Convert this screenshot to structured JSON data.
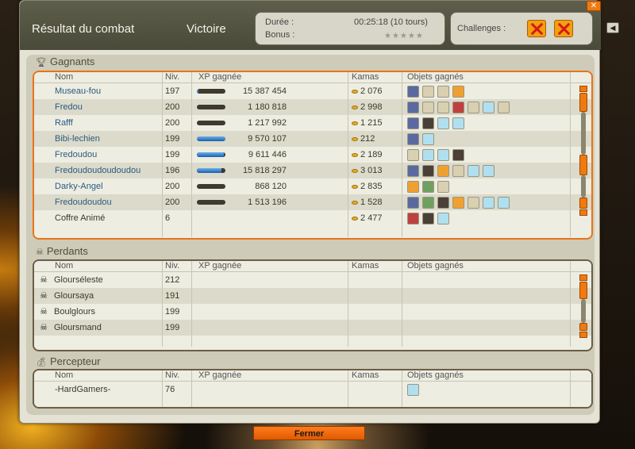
{
  "header": {
    "title": "Résultat du combat",
    "result": "Victoire",
    "duration_label": "Durée :",
    "duration_value": "00:25:18 (10 tours)",
    "bonus_label": "Bonus :",
    "bonus_stars": "★★★★★",
    "challenges_label": "Challenges :"
  },
  "columns": {
    "name": "Nom",
    "level": "Niv.",
    "xp": "XP gagnée",
    "kamas": "Kamas",
    "items": "Objets gagnés"
  },
  "winners": {
    "title": "Gagnants",
    "rows": [
      {
        "name": "Museau-fou",
        "level": "197",
        "xp": "15 387 454",
        "xp_fill": 0.05,
        "kamas": "2 076",
        "items": [
          "t-blue",
          "t-bone",
          "t-bone",
          "t-orange"
        ],
        "link": true
      },
      {
        "name": "Fredou",
        "level": "200",
        "xp": "1 180 818",
        "xp_fill": 0.0,
        "kamas": "2 998",
        "items": [
          "t-blue",
          "t-bone",
          "t-bone",
          "t-red",
          "t-bone",
          "t-cloud",
          "t-bone"
        ],
        "link": true
      },
      {
        "name": "Rafff",
        "level": "200",
        "xp": "1 217 992",
        "xp_fill": 0.0,
        "kamas": "1 215",
        "items": [
          "t-blue",
          "t-dark",
          "t-cloud",
          "t-cloud"
        ],
        "link": true
      },
      {
        "name": "Bibi-lechien",
        "level": "199",
        "xp": "9 570 107",
        "xp_fill": 1.0,
        "kamas": "212",
        "items": [
          "t-blue",
          "t-cloud"
        ],
        "link": true
      },
      {
        "name": "Fredoudou",
        "level": "199",
        "xp": "9 611 446",
        "xp_fill": 0.95,
        "kamas": "2 189",
        "items": [
          "t-bone",
          "t-cloud",
          "t-cloud",
          "t-dark"
        ],
        "link": true
      },
      {
        "name": "Fredoudoudoudoudou",
        "level": "196",
        "xp": "15 818 297",
        "xp_fill": 0.85,
        "kamas": "3 013",
        "items": [
          "t-blue",
          "t-dark",
          "t-orange",
          "t-bone",
          "t-cloud",
          "t-cloud"
        ],
        "link": true
      },
      {
        "name": "Darky-Angel",
        "level": "200",
        "xp": "868 120",
        "xp_fill": 0.0,
        "kamas": "2 835",
        "items": [
          "t-orange",
          "t-green",
          "t-bone"
        ],
        "link": true
      },
      {
        "name": "Fredoudoudou",
        "level": "200",
        "xp": "1 513 196",
        "xp_fill": 0.0,
        "kamas": "1 528",
        "items": [
          "t-blue",
          "t-green",
          "t-dark",
          "t-orange",
          "t-bone",
          "t-cloud",
          "t-cloud"
        ],
        "link": true
      },
      {
        "name": "Coffre Animé",
        "level": "6",
        "xp": "",
        "xp_fill": null,
        "kamas": "2 477",
        "items": [
          "t-red",
          "t-dark",
          "t-cloud"
        ],
        "link": false
      }
    ]
  },
  "losers": {
    "title": "Perdants",
    "rows": [
      {
        "name": "Glourséleste",
        "level": "212"
      },
      {
        "name": "Gloursaya",
        "level": "191"
      },
      {
        "name": "Boulglours",
        "level": "199"
      },
      {
        "name": "Gloursmand",
        "level": "199"
      }
    ]
  },
  "collector": {
    "title": "Percepteur",
    "rows": [
      {
        "name": "-HardGamers-",
        "level": "76",
        "items": [
          "t-cloud"
        ]
      }
    ]
  },
  "footer": {
    "close_label": "Fermer"
  }
}
